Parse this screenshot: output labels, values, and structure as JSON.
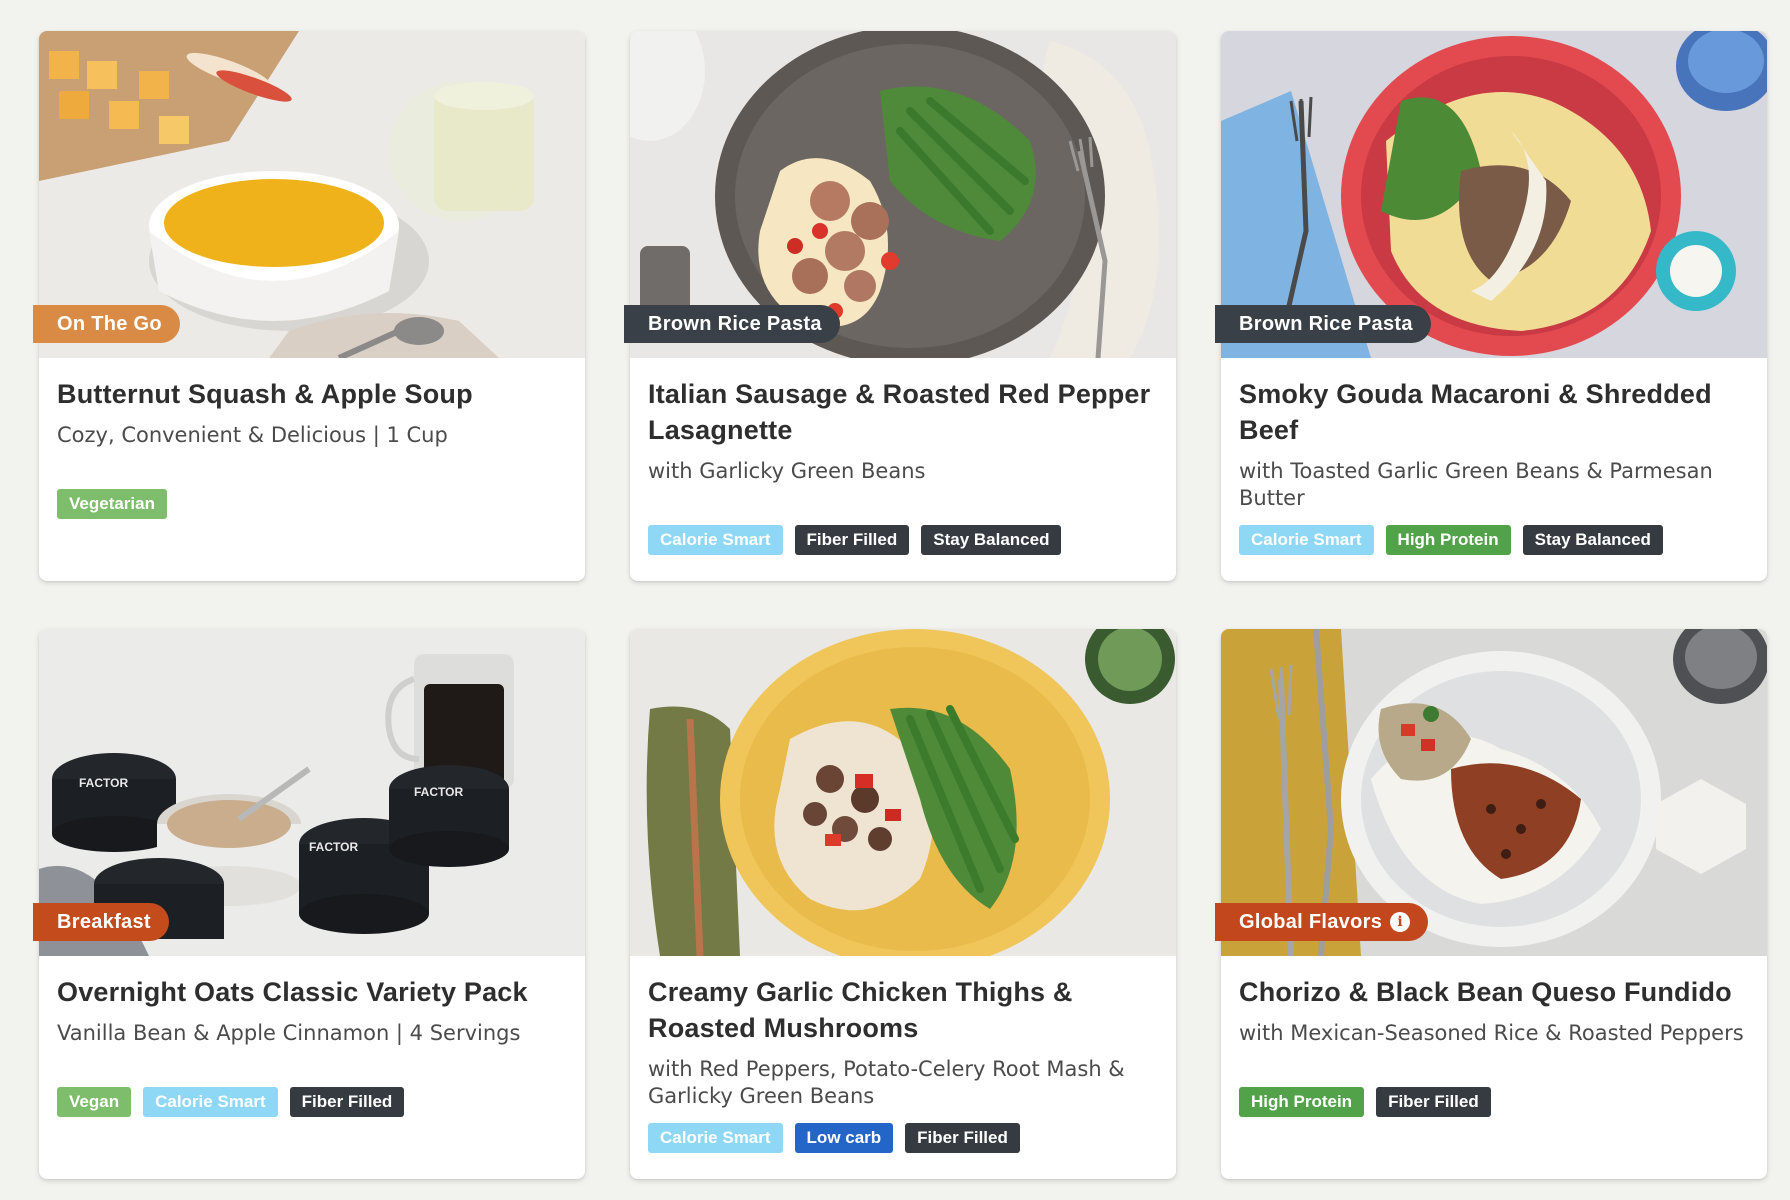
{
  "colors": {
    "page_background": "#f2f2ee",
    "on_the_go": "#d98b45",
    "brown_rice_pasta": "#3a4047",
    "breakfast": "#c44b1c",
    "global_flavors": "#c2471c",
    "vegetarian": "#7dbd6c",
    "calorie_smart": "#8ed8f6",
    "fiber_filled": "#353b40",
    "stay_balanced": "#353b40",
    "high_protein": "#52a24a",
    "low_carb": "#2466c8"
  },
  "meals": [
    {
      "category": "On The Go",
      "title": "Butternut Squash & Apple Soup",
      "subtitle": "Cozy, Convenient & Delicious | 1 Cup",
      "tags": [
        "Vegetarian"
      ]
    },
    {
      "category": "Brown Rice Pasta",
      "title": "Italian Sausage & Roasted Red Pepper Lasagnette",
      "subtitle": "with Garlicky Green Beans",
      "tags": [
        "Calorie Smart",
        "Fiber Filled",
        "Stay Balanced"
      ]
    },
    {
      "category": "Brown Rice Pasta",
      "title": "Smoky Gouda Macaroni & Shredded Beef",
      "subtitle": "with Toasted Garlic Green Beans & Parmesan Butter",
      "tags": [
        "Calorie Smart",
        "High Protein",
        "Stay Balanced"
      ]
    },
    {
      "category": "Breakfast",
      "title": "Overnight Oats Classic Variety Pack",
      "subtitle": "Vanilla Bean & Apple Cinnamon | 4 Servings",
      "tags": [
        "Vegan",
        "Calorie Smart",
        "Fiber Filled"
      ],
      "brand_text": "FACTOR"
    },
    {
      "category": "",
      "title": "Creamy Garlic Chicken Thighs & Roasted Mushrooms",
      "subtitle": "with Red Peppers, Potato-Celery Root Mash & Garlicky Green Beans",
      "tags": [
        "Calorie Smart",
        "Low carb",
        "Fiber Filled"
      ]
    },
    {
      "category": "Global Flavors",
      "category_icon": "info-icon",
      "title": "Chorizo & Black Bean Queso Fundido",
      "subtitle": "with Mexican-Seasoned Rice & Roasted Peppers",
      "tags": [
        "High Protein",
        "Fiber Filled"
      ]
    }
  ]
}
